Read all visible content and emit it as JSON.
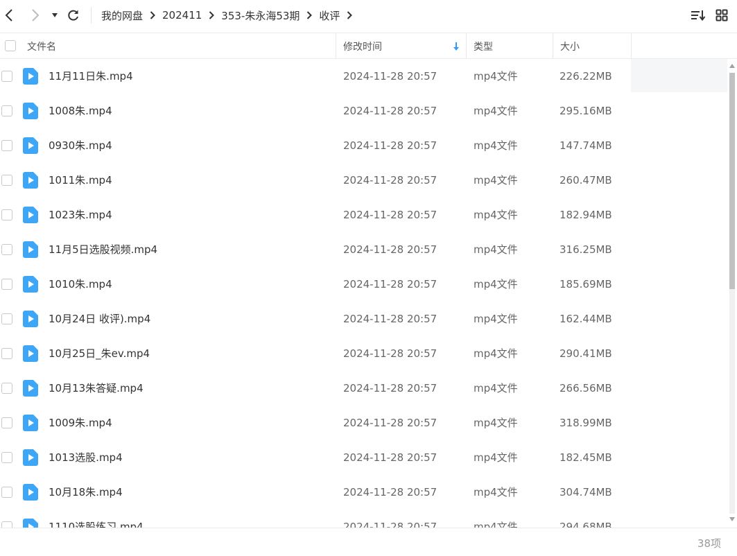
{
  "breadcrumb": [
    "我的网盘",
    "202411",
    "353-朱永海53期",
    "收评"
  ],
  "columns": {
    "name": "文件名",
    "modified": "修改时间",
    "type": "类型",
    "size": "大小"
  },
  "files": [
    {
      "name": "11月11日朱.mp4",
      "modified": "2024-11-28 20:57",
      "type": "mp4文件",
      "size": "226.22MB"
    },
    {
      "name": "1008朱.mp4",
      "modified": "2024-11-28 20:57",
      "type": "mp4文件",
      "size": "295.16MB"
    },
    {
      "name": "0930朱.mp4",
      "modified": "2024-11-28 20:57",
      "type": "mp4文件",
      "size": "147.74MB"
    },
    {
      "name": "1011朱.mp4",
      "modified": "2024-11-28 20:57",
      "type": "mp4文件",
      "size": "260.47MB"
    },
    {
      "name": "1023朱.mp4",
      "modified": "2024-11-28 20:57",
      "type": "mp4文件",
      "size": "182.94MB"
    },
    {
      "name": "11月5日选股视频.mp4",
      "modified": "2024-11-28 20:57",
      "type": "mp4文件",
      "size": "316.25MB"
    },
    {
      "name": "1010朱.mp4",
      "modified": "2024-11-28 20:57",
      "type": "mp4文件",
      "size": "185.69MB"
    },
    {
      "name": "10月24日 收评).mp4",
      "modified": "2024-11-28 20:57",
      "type": "mp4文件",
      "size": "162.44MB"
    },
    {
      "name": "10月25日_朱ev.mp4",
      "modified": "2024-11-28 20:57",
      "type": "mp4文件",
      "size": "290.41MB"
    },
    {
      "name": "10月13朱答疑.mp4",
      "modified": "2024-11-28 20:57",
      "type": "mp4文件",
      "size": "266.56MB"
    },
    {
      "name": "1009朱.mp4",
      "modified": "2024-11-28 20:57",
      "type": "mp4文件",
      "size": "318.99MB"
    },
    {
      "name": "1013选股.mp4",
      "modified": "2024-11-28 20:57",
      "type": "mp4文件",
      "size": "182.45MB"
    },
    {
      "name": "10月18朱.mp4",
      "modified": "2024-11-28 20:57",
      "type": "mp4文件",
      "size": "304.74MB"
    },
    {
      "name": "1110选股练习.mp4",
      "modified": "2024-11-28 20:57",
      "type": "mp4文件",
      "size": "294.68MB"
    }
  ],
  "footer": {
    "count": "38项"
  },
  "colors": {
    "accent": "#2f9bff",
    "file_icon": "#3ea6f7"
  }
}
